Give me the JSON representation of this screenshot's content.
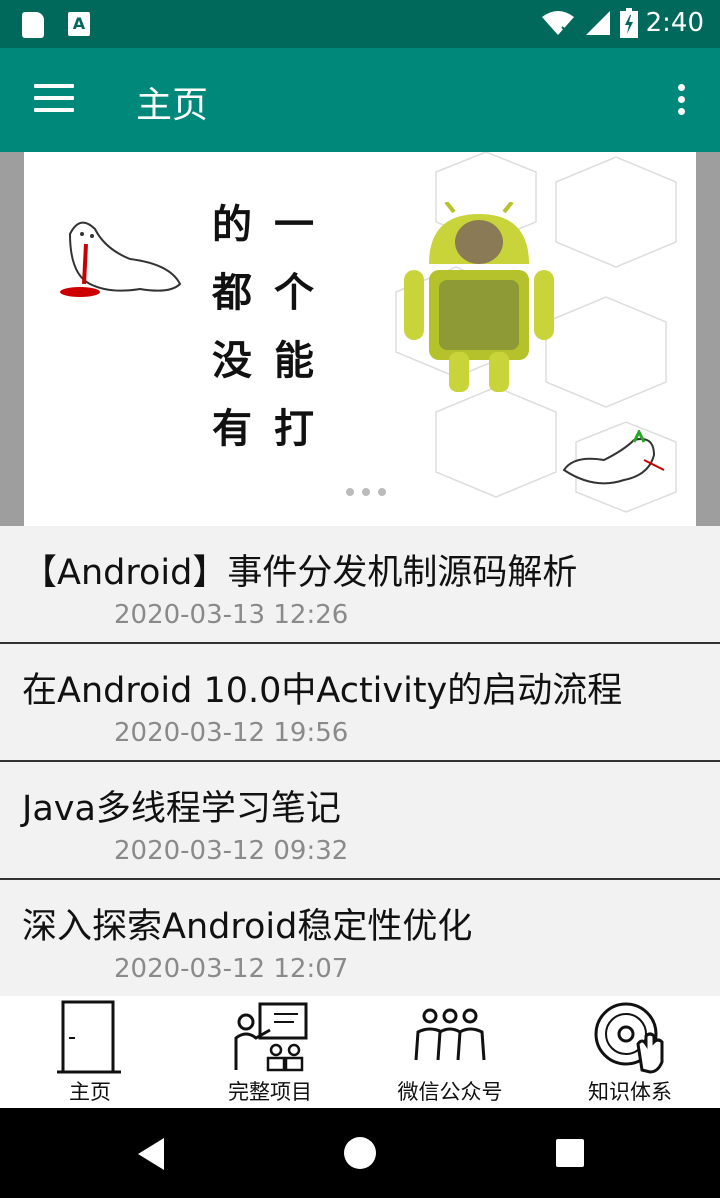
{
  "status": {
    "time": "2:40",
    "a_icon": "A"
  },
  "toolbar": {
    "title": "主页"
  },
  "banner": {
    "chars": [
      "的",
      "一",
      "都",
      "个",
      "没",
      "能",
      "有",
      "打"
    ]
  },
  "articles": [
    {
      "title": "【Android】事件分发机制源码解析",
      "date": "2020-03-13 12:26"
    },
    {
      "title": "在Android 10.0中Activity的启动流程",
      "date": "2020-03-12 19:56"
    },
    {
      "title": "Java多线程学习笔记",
      "date": "2020-03-12 09:32"
    },
    {
      "title": "深入探索Android稳定性优化",
      "date": "2020-03-12 12:07"
    }
  ],
  "nav": {
    "tabs": [
      {
        "label": "主页"
      },
      {
        "label": "完整项目"
      },
      {
        "label": "微信公众号"
      },
      {
        "label": "知识体系"
      }
    ]
  },
  "colors": {
    "status_bar": "#00695c",
    "toolbar": "#00897b"
  },
  "icons": [
    "sd-card-icon",
    "a-icon",
    "wifi-icon",
    "signal-icon",
    "battery-icon",
    "menu-icon",
    "more-vert-icon",
    "door-icon",
    "teacher-board-icon",
    "people-group-icon",
    "vinyl-hand-icon",
    "back-icon",
    "home-icon",
    "recents-icon"
  ]
}
